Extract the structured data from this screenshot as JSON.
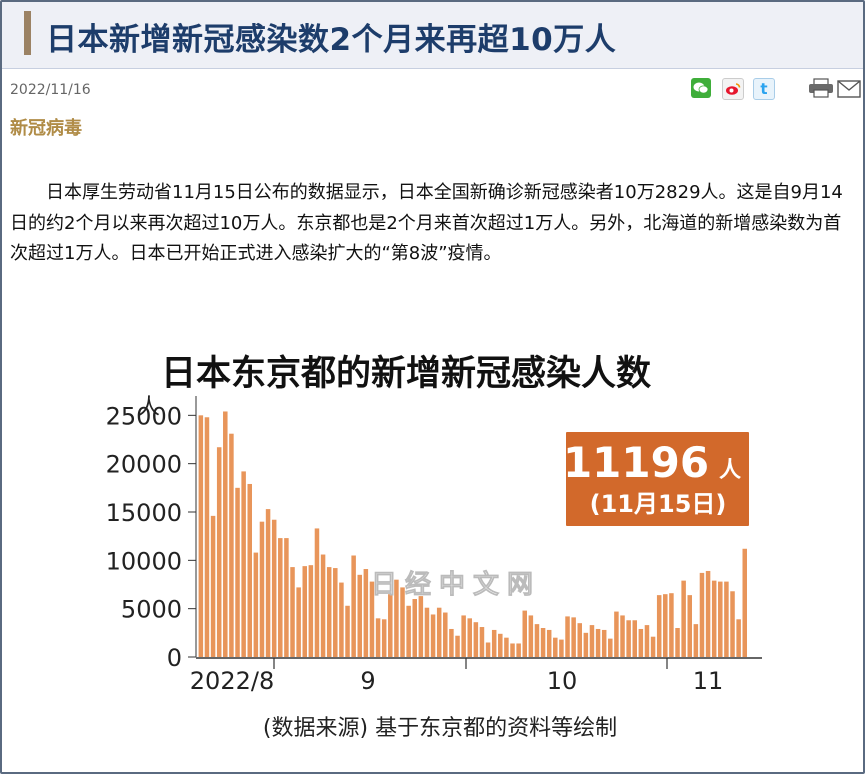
{
  "article": {
    "title": "日本新增新冠感染数2个月来再超10万人",
    "date": "2022/11/16",
    "category": "新冠病毒",
    "body": "日本厚生劳动省11月15日公布的数据显示，日本全国新确诊新冠感染者10万2829人。这是自9月14日的约2个月以来再次超过10万人。东京都也是2个月来首次超过1万人。另外，北海道的新增感染数为首次超过1万人。日本已开始正式进入感染扩大的“第8波”疫情。"
  },
  "share": {
    "icons": [
      "wechat-icon",
      "weibo-icon",
      "twitter-icon"
    ],
    "tools": [
      "print-icon",
      "mail-icon"
    ]
  },
  "colors": {
    "title": "#1d3d6b",
    "accent_bar": "#9b8264",
    "category": "#b08c47",
    "bar_fill": "#e8955a",
    "callout": "#d2692b"
  },
  "chart_data": {
    "type": "bar",
    "title": "日本东京都的新增新冠感染人数",
    "ylabel": "人",
    "ylim": [
      0,
      27000
    ],
    "yticks": [
      0,
      5000,
      10000,
      15000,
      20000,
      25000
    ],
    "xtick_labels": [
      "2022/8",
      "9",
      "10",
      "11"
    ],
    "callout": {
      "value": "11196",
      "unit": "人",
      "date": "(11月15日)"
    },
    "source": "(数据来源) 基于东京都的资料等绘制",
    "watermark": "日经中文网",
    "values": [
      25000,
      24800,
      14600,
      21700,
      25400,
      23100,
      17500,
      19200,
      17900,
      10800,
      14000,
      15300,
      14200,
      12300,
      12300,
      9300,
      7200,
      9400,
      9500,
      13300,
      10600,
      9300,
      9200,
      7700,
      5300,
      10500,
      8500,
      9100,
      7800,
      4000,
      3900,
      6500,
      8000,
      7200,
      5300,
      6000,
      6300,
      5100,
      4400,
      5100,
      4600,
      2900,
      2200,
      4300,
      4000,
      3600,
      3100,
      1500,
      2800,
      2400,
      2000,
      1400,
      1400,
      4800,
      4300,
      3400,
      3000,
      2800,
      2000,
      1800,
      4200,
      4100,
      3500,
      2500,
      3300,
      2900,
      2800,
      1900,
      4700,
      4300,
      3800,
      3800,
      2900,
      3300,
      2100,
      6400,
      6500,
      6600,
      3000,
      7900,
      6400,
      3400,
      8700,
      8900,
      7900,
      7800,
      7800,
      6800,
      3900,
      11196
    ]
  }
}
